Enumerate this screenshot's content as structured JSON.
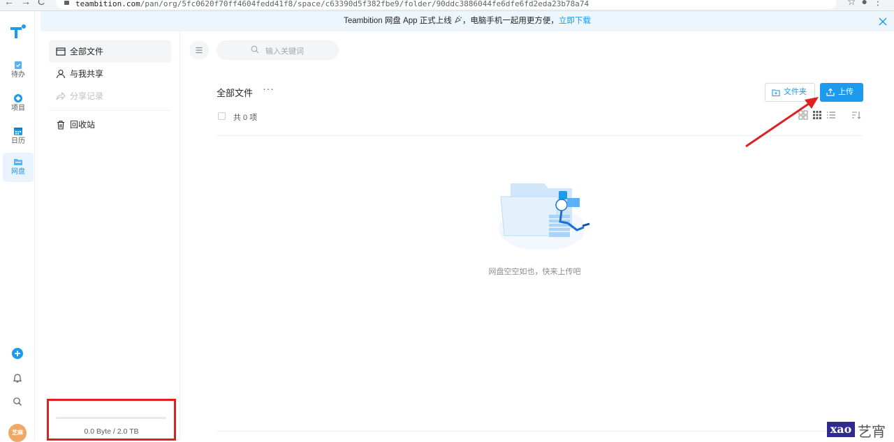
{
  "browser": {
    "host": "teambition.com",
    "path": "/pan/org/5fc0620f70ff4604fedd41f8/space/c63390d5f382fbe9/folder/90ddc3886044fe6dfe6fd2eda23b78a74"
  },
  "rail": {
    "items": [
      {
        "label": "待办",
        "icon": "todo-icon"
      },
      {
        "label": "项目",
        "icon": "project-icon"
      },
      {
        "label": "日历",
        "icon": "calendar-icon"
      },
      {
        "label": "网盘",
        "icon": "drive-icon"
      }
    ],
    "avatar_text": "芝麻"
  },
  "banner": {
    "text": "Teambition 网盘 App 正式上线 ",
    "text2": "，电脑手机一起用更方便，",
    "link": "立即下载"
  },
  "sidebar": {
    "items": [
      {
        "label": "全部文件",
        "icon": "folder-icon"
      },
      {
        "label": "与我共享",
        "icon": "user-icon"
      },
      {
        "label": "分享记录",
        "icon": "share-icon"
      },
      {
        "label": "回收站",
        "icon": "trash-icon"
      }
    ],
    "storage_text": "0.0 Byte / 2.0 TB",
    "storage_used_fraction": 0
  },
  "main": {
    "search_placeholder": "输入关键词",
    "title": "全部文件",
    "more": "···",
    "new_folder_label": "文件夹",
    "upload_label": "上传",
    "count_text": "共 0 项",
    "empty_text": "网盘空空如也，快来上传吧"
  },
  "watermark": {
    "badge": "xao",
    "text": "艺宵"
  },
  "colors": {
    "accent": "#1b9aee",
    "annotation": "#e02020"
  }
}
